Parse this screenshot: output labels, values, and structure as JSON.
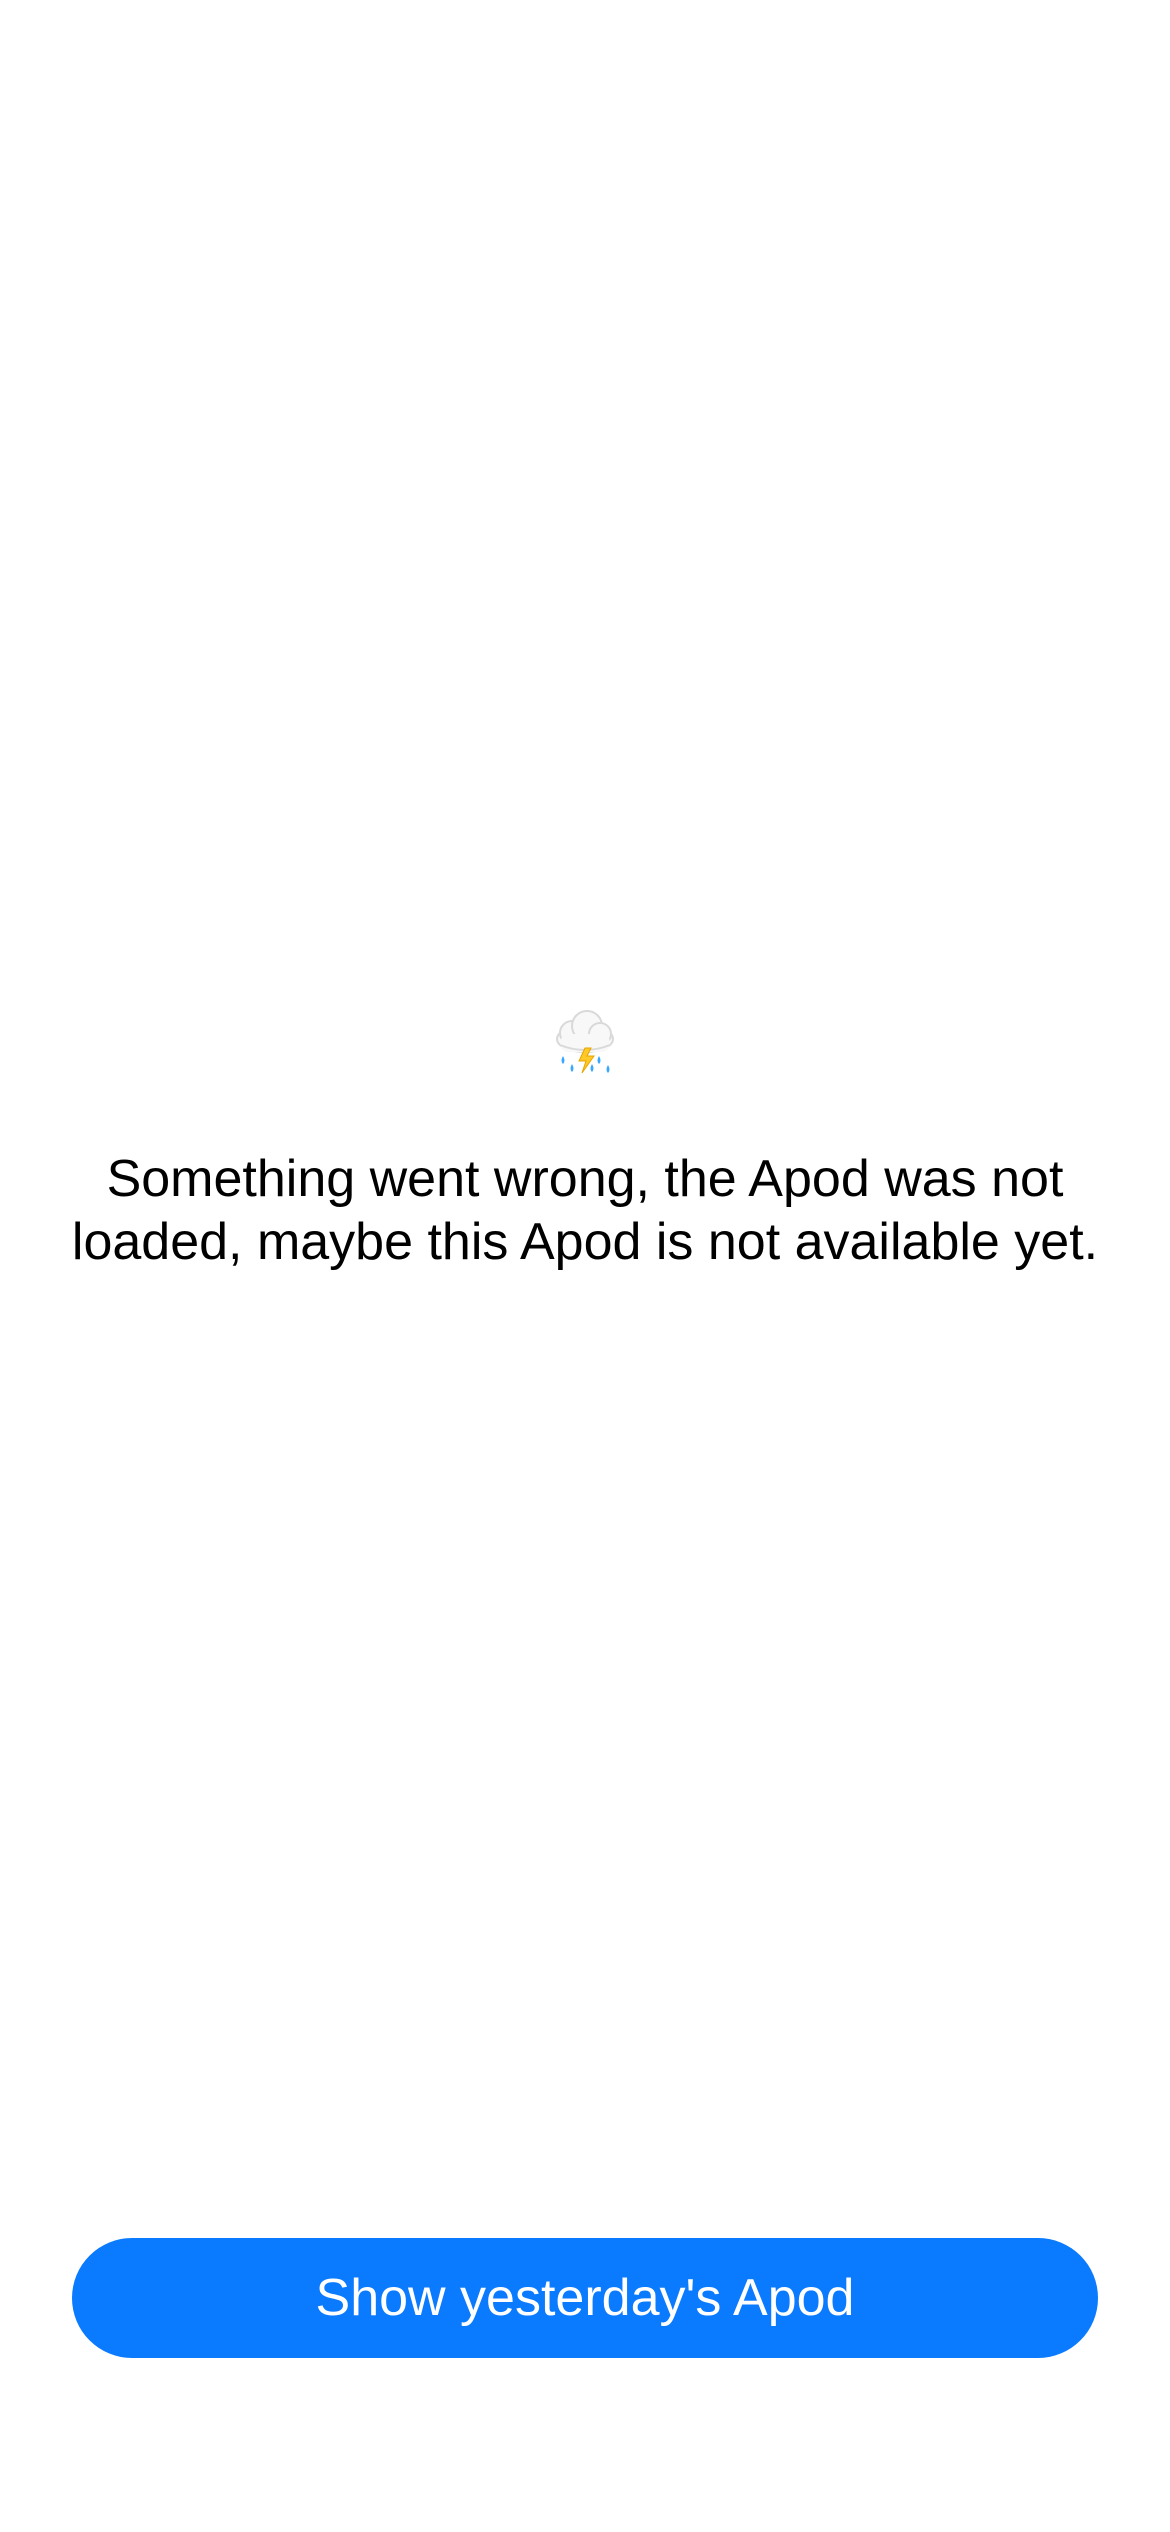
{
  "error_state": {
    "icon": "cloud-with-lightning-and-rain-icon",
    "message": "Something went wrong, the Apod was not loaded, maybe this Apod is not available yet."
  },
  "actions": {
    "show_yesterday_label": "Show yesterday's Apod"
  },
  "colors": {
    "background": "#ffffff",
    "text": "#000000",
    "accent": "#0a7aff",
    "button_text": "#ffffff"
  }
}
